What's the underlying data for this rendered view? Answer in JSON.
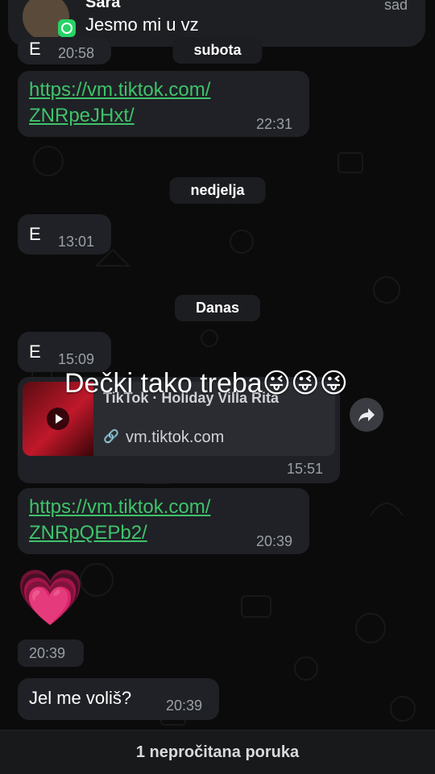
{
  "notification": {
    "sender": "Sara",
    "message": "Jesmo mi u vz",
    "time": "sad"
  },
  "separators": {
    "saturday": "subota",
    "sunday": "nedjelja",
    "today": "Danas"
  },
  "messages": {
    "m0": {
      "text": "E",
      "time": "20:58"
    },
    "m1": {
      "link_line1": "https://vm.tiktok.com/",
      "link_line2": "ZNRpeJHxt/",
      "time": "22:31"
    },
    "m2": {
      "text": "E",
      "time": "13:01"
    },
    "m3": {
      "text": "E",
      "time": "15:09"
    },
    "m4": {
      "overlay_caption": "Dečki tako treba😜😜😜",
      "preview_title": "TikTok · Holiday Villa Rita",
      "preview_domain": "vm.tiktok.com",
      "time": "15:51"
    },
    "m5": {
      "link_line1": "https://vm.tiktok.com/",
      "link_line2": "ZNRpQEPb2/",
      "time": "20:39"
    },
    "m6": {
      "emoji": "💗",
      "time": "20:39"
    },
    "m7": {
      "text": "Jel me voliš?",
      "time": "20:39"
    }
  },
  "bottom_bar": {
    "label": "1 nepročitana poruka"
  }
}
